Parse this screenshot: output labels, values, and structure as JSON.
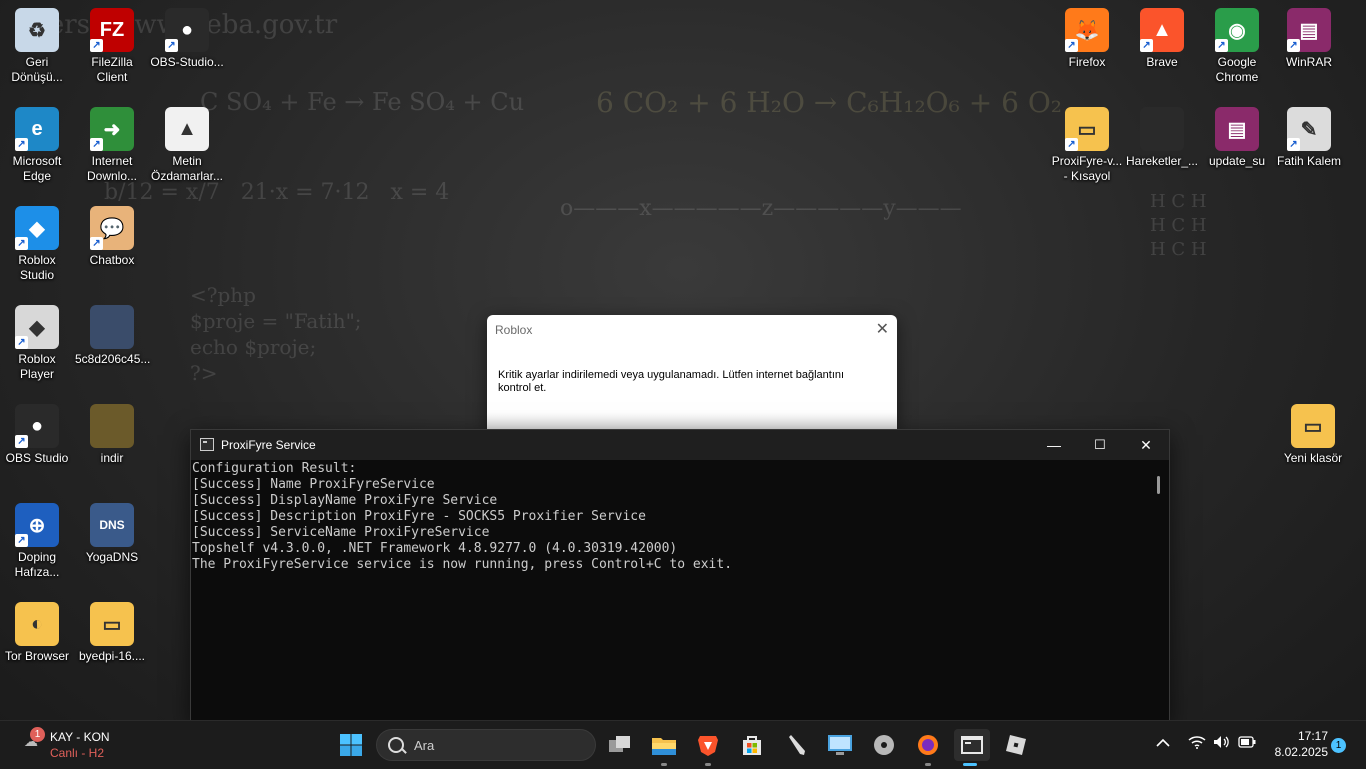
{
  "desktop": {
    "left_icons": [
      {
        "label": "Geri Dönüşü...",
        "icon": "recycle-bin-icon",
        "color": "#c8d8e8",
        "glyph": "♻",
        "shortcut": false
      },
      {
        "label": "FileZilla Client",
        "icon": "filezilla-icon",
        "color": "#bf0000",
        "glyph": "FZ",
        "shortcut": true
      },
      {
        "label": "OBS-Studio...",
        "icon": "obs-icon",
        "color": "#2a2a2a",
        "glyph": "●",
        "shortcut": true
      },
      {
        "label": "Microsoft Edge",
        "icon": "edge-icon",
        "color": "#1e88c7",
        "glyph": "e",
        "shortcut": true
      },
      {
        "label": "Internet Downlo...",
        "icon": "idm-icon",
        "color": "#2f8f3a",
        "glyph": "➜",
        "shortcut": true
      },
      {
        "label": "Metin Özdamarlar...",
        "icon": "brave-html-icon",
        "color": "#f1f1f1",
        "glyph": "▲",
        "shortcut": false
      },
      {
        "label": "Roblox Studio",
        "icon": "roblox-studio-icon",
        "color": "#1d8fe8",
        "glyph": "◆",
        "shortcut": true
      },
      {
        "label": "Chatbox",
        "icon": "chatbox-icon",
        "color": "#e8b37a",
        "glyph": "💬",
        "shortcut": true
      },
      {
        "label": "Roblox Player",
        "icon": "roblox-player-icon",
        "color": "#d8d8d8",
        "glyph": "◆",
        "shortcut": true
      },
      {
        "label": "5c8d206c45...",
        "icon": "image-thumbnail-icon",
        "color": "#3a4c6a",
        "glyph": "",
        "shortcut": false
      },
      {
        "label": "OBS Studio",
        "icon": "obs-studio-icon",
        "color": "#2a2a2a",
        "glyph": "●",
        "shortcut": true
      },
      {
        "label": "indir",
        "icon": "image-thumbnail-icon",
        "color": "#6b5a2a",
        "glyph": "",
        "shortcut": false
      },
      {
        "label": "Doping Hafıza...",
        "icon": "doping-icon",
        "color": "#1e5fbf",
        "glyph": "⊕",
        "shortcut": true
      },
      {
        "label": "YogaDNS",
        "icon": "yogadns-icon",
        "color": "#3a5a8a",
        "glyph": "DNS",
        "shortcut": false
      },
      {
        "label": "Tor Browser",
        "icon": "tor-folder-icon",
        "color": "#f6c24e",
        "glyph": "◐",
        "shortcut": false
      },
      {
        "label": "byedpi-16....",
        "icon": "folder-icon",
        "color": "#f6c24e",
        "glyph": "▭",
        "shortcut": false
      }
    ],
    "right_icons": [
      {
        "label": "Firefox",
        "icon": "firefox-icon",
        "color": "#ff7a1a",
        "glyph": "🦊",
        "shortcut": true
      },
      {
        "label": "Brave",
        "icon": "brave-icon",
        "color": "#fb542b",
        "glyph": "▲",
        "shortcut": true
      },
      {
        "label": "Google Chrome",
        "icon": "chrome-icon",
        "color": "#2a9d4a",
        "glyph": "◉",
        "shortcut": true
      },
      {
        "label": "WinRAR",
        "icon": "winrar-icon",
        "color": "#8a2a6a",
        "glyph": "▤",
        "shortcut": true
      },
      {
        "label": "ProxiFyre-v... - Kısayol",
        "icon": "folder-shortcut-icon",
        "color": "#f6c24e",
        "glyph": "▭",
        "shortcut": true
      },
      {
        "label": "Hareketler_...",
        "icon": "file-icon",
        "color": "#2a2a2a",
        "glyph": "",
        "shortcut": false
      },
      {
        "label": "update_su",
        "icon": "winrar-archive-icon",
        "color": "#8a2a6a",
        "glyph": "▤",
        "shortcut": false
      },
      {
        "label": "Fatih Kalem",
        "icon": "pen-icon",
        "color": "#dcdcdc",
        "glyph": "✎",
        "shortcut": true
      },
      {
        "label": "Yeni klasör",
        "icon": "folder-icon",
        "color": "#f6c24e",
        "glyph": "▭",
        "shortcut": false
      }
    ]
  },
  "dialog": {
    "title": "Roblox",
    "message": "Kritik ayarlar indirilemedi veya uygulanamadı. Lütfen internet bağlantını kontrol et.",
    "close_glyph": "✕"
  },
  "console": {
    "title": "ProxiFyre Service",
    "minimize_glyph": "—",
    "maximize_glyph": "☐",
    "close_glyph": "✕",
    "lines": [
      "Configuration Result:",
      "[Success] Name ProxiFyreService",
      "[Success] DisplayName ProxiFyre Service",
      "[Success] Description ProxiFyre - SOCKS5 Proxifier Service",
      "[Success] ServiceName ProxiFyreService",
      "Topshelf v4.3.0.0, .NET Framework 4.8.9277.0 (4.0.30319.42000)",
      "The ProxiFyreService service is now running, press Control+C to exit."
    ]
  },
  "taskbar": {
    "weather": {
      "badge": "1",
      "title": "KAY - KON",
      "subtitle": "Canlı - H2"
    },
    "search_placeholder": "Ara",
    "clock": {
      "time": "17:17",
      "date": "8.02.2025"
    },
    "notification_count": "1",
    "accent": "#4cc2ff",
    "weather_subtitle_color": "#e0605a"
  }
}
